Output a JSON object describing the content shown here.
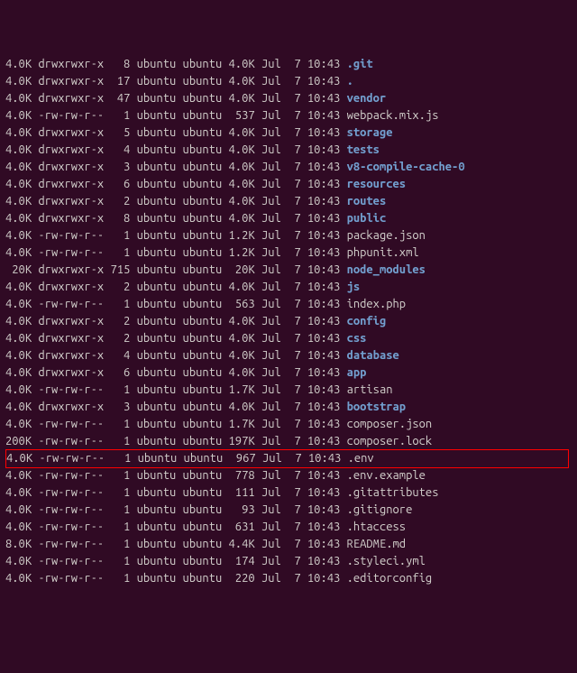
{
  "listing": [
    {
      "blocks": "4.0K",
      "perm": "drwxrwxr-x",
      "links": "8",
      "owner": "ubuntu",
      "group": "ubuntu",
      "size": "4.0K",
      "month": "Jul",
      "day": "7",
      "time": "10:43",
      "name": ".git",
      "type": "dir",
      "hl": false
    },
    {
      "blocks": "4.0K",
      "perm": "drwxrwxr-x",
      "links": "17",
      "owner": "ubuntu",
      "group": "ubuntu",
      "size": "4.0K",
      "month": "Jul",
      "day": "7",
      "time": "10:43",
      "name": ".",
      "type": "dir",
      "hl": false
    },
    {
      "blocks": "4.0K",
      "perm": "drwxrwxr-x",
      "links": "47",
      "owner": "ubuntu",
      "group": "ubuntu",
      "size": "4.0K",
      "month": "Jul",
      "day": "7",
      "time": "10:43",
      "name": "vendor",
      "type": "dir",
      "hl": false
    },
    {
      "blocks": "4.0K",
      "perm": "-rw-rw-r--",
      "links": "1",
      "owner": "ubuntu",
      "group": "ubuntu",
      "size": "537",
      "month": "Jul",
      "day": "7",
      "time": "10:43",
      "name": "webpack.mix.js",
      "type": "file",
      "hl": false
    },
    {
      "blocks": "4.0K",
      "perm": "drwxrwxr-x",
      "links": "5",
      "owner": "ubuntu",
      "group": "ubuntu",
      "size": "4.0K",
      "month": "Jul",
      "day": "7",
      "time": "10:43",
      "name": "storage",
      "type": "dir",
      "hl": false
    },
    {
      "blocks": "4.0K",
      "perm": "drwxrwxr-x",
      "links": "4",
      "owner": "ubuntu",
      "group": "ubuntu",
      "size": "4.0K",
      "month": "Jul",
      "day": "7",
      "time": "10:43",
      "name": "tests",
      "type": "dir",
      "hl": false
    },
    {
      "blocks": "4.0K",
      "perm": "drwxrwxr-x",
      "links": "3",
      "owner": "ubuntu",
      "group": "ubuntu",
      "size": "4.0K",
      "month": "Jul",
      "day": "7",
      "time": "10:43",
      "name": "v8-compile-cache-0",
      "type": "dir",
      "hl": false
    },
    {
      "blocks": "4.0K",
      "perm": "drwxrwxr-x",
      "links": "6",
      "owner": "ubuntu",
      "group": "ubuntu",
      "size": "4.0K",
      "month": "Jul",
      "day": "7",
      "time": "10:43",
      "name": "resources",
      "type": "dir",
      "hl": false
    },
    {
      "blocks": "4.0K",
      "perm": "drwxrwxr-x",
      "links": "2",
      "owner": "ubuntu",
      "group": "ubuntu",
      "size": "4.0K",
      "month": "Jul",
      "day": "7",
      "time": "10:43",
      "name": "routes",
      "type": "dir",
      "hl": false
    },
    {
      "blocks": "4.0K",
      "perm": "drwxrwxr-x",
      "links": "8",
      "owner": "ubuntu",
      "group": "ubuntu",
      "size": "4.0K",
      "month": "Jul",
      "day": "7",
      "time": "10:43",
      "name": "public",
      "type": "dir",
      "hl": false
    },
    {
      "blocks": "4.0K",
      "perm": "-rw-rw-r--",
      "links": "1",
      "owner": "ubuntu",
      "group": "ubuntu",
      "size": "1.2K",
      "month": "Jul",
      "day": "7",
      "time": "10:43",
      "name": "package.json",
      "type": "file",
      "hl": false
    },
    {
      "blocks": "4.0K",
      "perm": "-rw-rw-r--",
      "links": "1",
      "owner": "ubuntu",
      "group": "ubuntu",
      "size": "1.2K",
      "month": "Jul",
      "day": "7",
      "time": "10:43",
      "name": "phpunit.xml",
      "type": "file",
      "hl": false
    },
    {
      "blocks": "20K",
      "perm": "drwxrwxr-x",
      "links": "715",
      "owner": "ubuntu",
      "group": "ubuntu",
      "size": "20K",
      "month": "Jul",
      "day": "7",
      "time": "10:43",
      "name": "node_modules",
      "type": "dir",
      "hl": false
    },
    {
      "blocks": "4.0K",
      "perm": "drwxrwxr-x",
      "links": "2",
      "owner": "ubuntu",
      "group": "ubuntu",
      "size": "4.0K",
      "month": "Jul",
      "day": "7",
      "time": "10:43",
      "name": "js",
      "type": "dir",
      "hl": false
    },
    {
      "blocks": "4.0K",
      "perm": "-rw-rw-r--",
      "links": "1",
      "owner": "ubuntu",
      "group": "ubuntu",
      "size": "563",
      "month": "Jul",
      "day": "7",
      "time": "10:43",
      "name": "index.php",
      "type": "file",
      "hl": false
    },
    {
      "blocks": "4.0K",
      "perm": "drwxrwxr-x",
      "links": "2",
      "owner": "ubuntu",
      "group": "ubuntu",
      "size": "4.0K",
      "month": "Jul",
      "day": "7",
      "time": "10:43",
      "name": "config",
      "type": "dir",
      "hl": false
    },
    {
      "blocks": "4.0K",
      "perm": "drwxrwxr-x",
      "links": "2",
      "owner": "ubuntu",
      "group": "ubuntu",
      "size": "4.0K",
      "month": "Jul",
      "day": "7",
      "time": "10:43",
      "name": "css",
      "type": "dir",
      "hl": false
    },
    {
      "blocks": "4.0K",
      "perm": "drwxrwxr-x",
      "links": "4",
      "owner": "ubuntu",
      "group": "ubuntu",
      "size": "4.0K",
      "month": "Jul",
      "day": "7",
      "time": "10:43",
      "name": "database",
      "type": "dir",
      "hl": false
    },
    {
      "blocks": "4.0K",
      "perm": "drwxrwxr-x",
      "links": "6",
      "owner": "ubuntu",
      "group": "ubuntu",
      "size": "4.0K",
      "month": "Jul",
      "day": "7",
      "time": "10:43",
      "name": "app",
      "type": "dir",
      "hl": false
    },
    {
      "blocks": "4.0K",
      "perm": "-rw-rw-r--",
      "links": "1",
      "owner": "ubuntu",
      "group": "ubuntu",
      "size": "1.7K",
      "month": "Jul",
      "day": "7",
      "time": "10:43",
      "name": "artisan",
      "type": "file",
      "hl": false
    },
    {
      "blocks": "4.0K",
      "perm": "drwxrwxr-x",
      "links": "3",
      "owner": "ubuntu",
      "group": "ubuntu",
      "size": "4.0K",
      "month": "Jul",
      "day": "7",
      "time": "10:43",
      "name": "bootstrap",
      "type": "dir",
      "hl": false
    },
    {
      "blocks": "4.0K",
      "perm": "-rw-rw-r--",
      "links": "1",
      "owner": "ubuntu",
      "group": "ubuntu",
      "size": "1.7K",
      "month": "Jul",
      "day": "7",
      "time": "10:43",
      "name": "composer.json",
      "type": "file",
      "hl": false
    },
    {
      "blocks": "200K",
      "perm": "-rw-rw-r--",
      "links": "1",
      "owner": "ubuntu",
      "group": "ubuntu",
      "size": "197K",
      "month": "Jul",
      "day": "7",
      "time": "10:43",
      "name": "composer.lock",
      "type": "file",
      "hl": false
    },
    {
      "blocks": "4.0K",
      "perm": "-rw-rw-r--",
      "links": "1",
      "owner": "ubuntu",
      "group": "ubuntu",
      "size": "967",
      "month": "Jul",
      "day": "7",
      "time": "10:43",
      "name": ".env",
      "type": "file",
      "hl": true
    },
    {
      "blocks": "4.0K",
      "perm": "-rw-rw-r--",
      "links": "1",
      "owner": "ubuntu",
      "group": "ubuntu",
      "size": "778",
      "month": "Jul",
      "day": "7",
      "time": "10:43",
      "name": ".env.example",
      "type": "file",
      "hl": false
    },
    {
      "blocks": "4.0K",
      "perm": "-rw-rw-r--",
      "links": "1",
      "owner": "ubuntu",
      "group": "ubuntu",
      "size": "111",
      "month": "Jul",
      "day": "7",
      "time": "10:43",
      "name": ".gitattributes",
      "type": "file",
      "hl": false
    },
    {
      "blocks": "4.0K",
      "perm": "-rw-rw-r--",
      "links": "1",
      "owner": "ubuntu",
      "group": "ubuntu",
      "size": "93",
      "month": "Jul",
      "day": "7",
      "time": "10:43",
      "name": ".gitignore",
      "type": "file",
      "hl": false
    },
    {
      "blocks": "4.0K",
      "perm": "-rw-rw-r--",
      "links": "1",
      "owner": "ubuntu",
      "group": "ubuntu",
      "size": "631",
      "month": "Jul",
      "day": "7",
      "time": "10:43",
      "name": ".htaccess",
      "type": "file",
      "hl": false
    },
    {
      "blocks": "8.0K",
      "perm": "-rw-rw-r--",
      "links": "1",
      "owner": "ubuntu",
      "group": "ubuntu",
      "size": "4.4K",
      "month": "Jul",
      "day": "7",
      "time": "10:43",
      "name": "README.md",
      "type": "file",
      "hl": false
    },
    {
      "blocks": "4.0K",
      "perm": "-rw-rw-r--",
      "links": "1",
      "owner": "ubuntu",
      "group": "ubuntu",
      "size": "174",
      "month": "Jul",
      "day": "7",
      "time": "10:43",
      "name": ".styleci.yml",
      "type": "file",
      "hl": false
    },
    {
      "blocks": "4.0K",
      "perm": "-rw-rw-r--",
      "links": "1",
      "owner": "ubuntu",
      "group": "ubuntu",
      "size": "220",
      "month": "Jul",
      "day": "7",
      "time": "10:43",
      "name": ".editorconfig",
      "type": "file",
      "hl": false
    }
  ]
}
